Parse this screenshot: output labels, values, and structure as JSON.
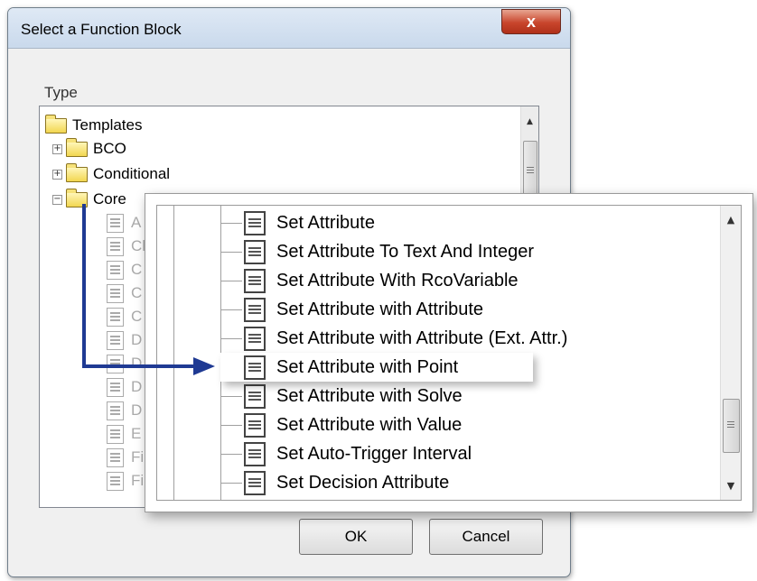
{
  "dialog": {
    "title": "Select a Function Block",
    "close_glyph": "x",
    "type_label": "Type",
    "ok_label": "OK",
    "cancel_label": "Cancel"
  },
  "tree": {
    "root": "Templates",
    "folders": [
      {
        "label": "BCO",
        "expander": "+"
      },
      {
        "label": "Conditional",
        "expander": "+"
      },
      {
        "label": "Core",
        "expander": "−"
      }
    ],
    "core_children": [
      "A",
      "Cl",
      "C",
      "C",
      "C",
      "D",
      "D",
      "D",
      "D",
      "E",
      "Fi",
      "Fi"
    ]
  },
  "zoom": {
    "items": [
      "Set Attribute",
      "Set Attribute To Text And Integer",
      "Set Attribute With RcoVariable",
      "Set Attribute with Attribute",
      "Set Attribute with Attribute (Ext. Attr.)",
      "Set Attribute with Point",
      "Set Attribute with Solve",
      "Set Attribute with Value",
      "Set Auto-Trigger Interval",
      "Set Decision Attribute"
    ],
    "highlighted_index": 5
  },
  "scroll": {
    "up_glyph": "▲",
    "down_glyph": "▼"
  },
  "colors": {
    "arrow": "#1f3a93",
    "close": "#c8452c"
  }
}
